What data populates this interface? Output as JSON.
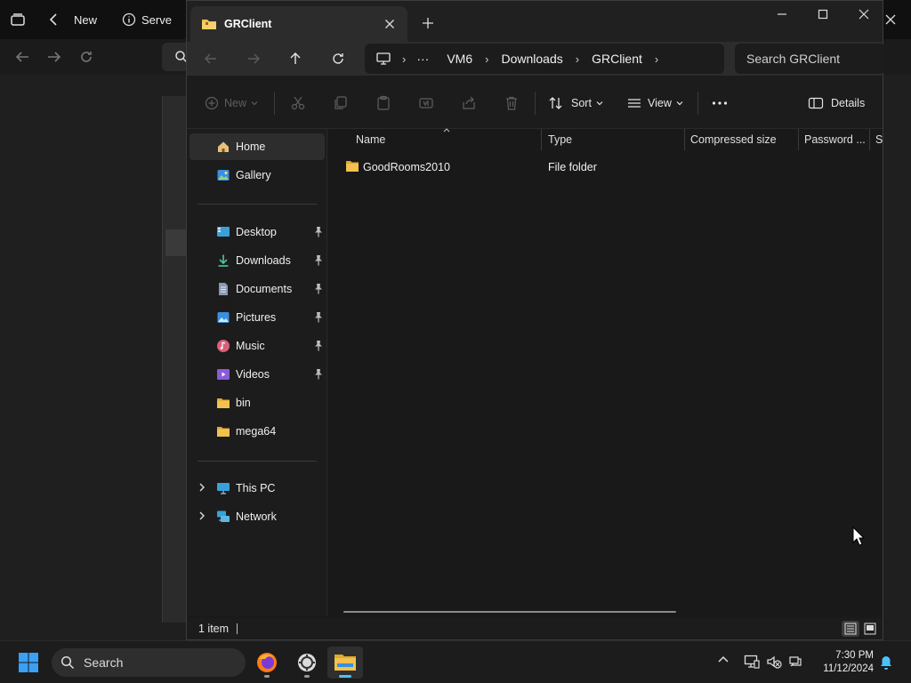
{
  "background_browser": {
    "tabs": [
      {
        "label": "New"
      },
      {
        "label": "Serve"
      }
    ]
  },
  "explorer": {
    "tab_title": "GRClient",
    "breadcrumb": [
      "VM6",
      "Downloads",
      "GRClient"
    ],
    "search_placeholder": "Search GRClient",
    "toolbar": {
      "new_label": "New",
      "sort_label": "Sort",
      "view_label": "View",
      "details_label": "Details"
    },
    "sidebar": {
      "top": [
        {
          "label": "Home",
          "icon": "home-icon",
          "selected": true
        },
        {
          "label": "Gallery",
          "icon": "gallery-icon"
        }
      ],
      "quick_access": [
        {
          "label": "Desktop",
          "icon": "desktop-icon",
          "pinned": true
        },
        {
          "label": "Downloads",
          "icon": "downloads-icon",
          "pinned": true
        },
        {
          "label": "Documents",
          "icon": "documents-icon",
          "pinned": true
        },
        {
          "label": "Pictures",
          "icon": "pictures-icon",
          "pinned": true
        },
        {
          "label": "Music",
          "icon": "music-icon",
          "pinned": true
        },
        {
          "label": "Videos",
          "icon": "videos-icon",
          "pinned": true
        },
        {
          "label": "bin",
          "icon": "folder-icon"
        },
        {
          "label": "mega64",
          "icon": "folder-icon"
        }
      ],
      "locations": [
        {
          "label": "This PC",
          "icon": "this-pc-icon"
        },
        {
          "label": "Network",
          "icon": "network-icon"
        }
      ]
    },
    "columns": [
      "Name",
      "Type",
      "Compressed size",
      "Password ...",
      "Si"
    ],
    "files": [
      {
        "name": "GoodRooms2010",
        "type": "File folder"
      }
    ],
    "status": "1 item"
  },
  "taskbar": {
    "search_placeholder": "Search",
    "time": "7:30 PM",
    "date": "11/12/2024"
  },
  "colors": {
    "folder": "#f2c14e",
    "accent": "#4cc2ff",
    "windows_logo": "#3aa0f3"
  }
}
